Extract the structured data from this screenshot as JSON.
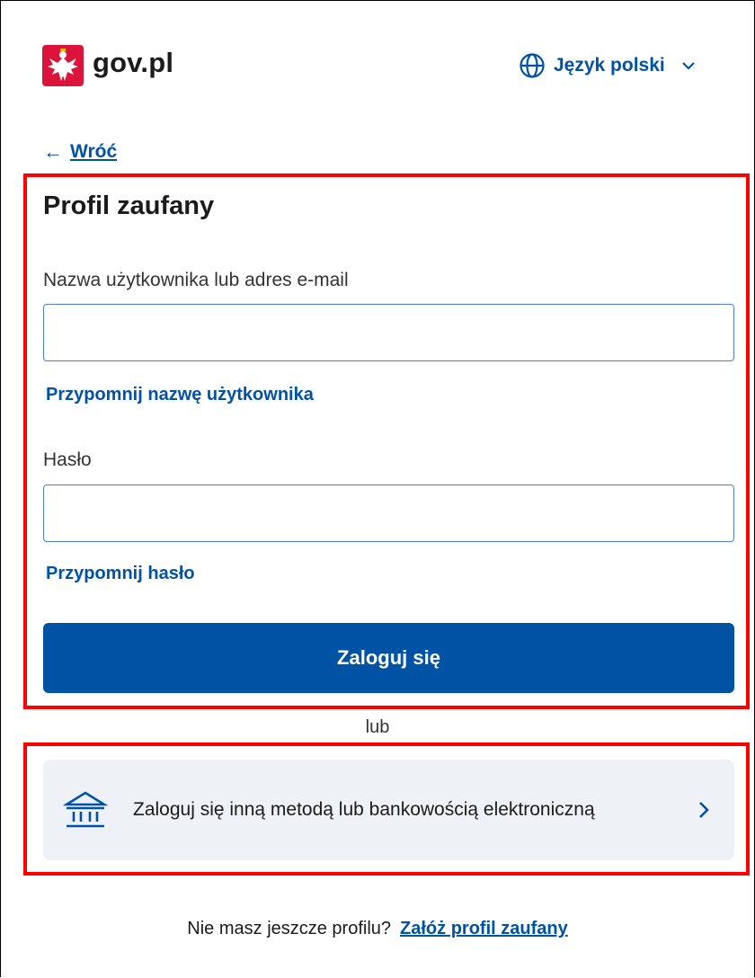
{
  "header": {
    "brand": "gov.pl",
    "language_label": "Język polski",
    "icons": {
      "logo": "polish-eagle-emblem",
      "language": "globe-icon",
      "dropdown": "chevron-down-icon"
    }
  },
  "nav": {
    "back_label": "Wróć",
    "back_icon": "arrow-left-icon"
  },
  "login_form": {
    "title": "Profil zaufany",
    "username_label": "Nazwa użytkownika lub adres e-mail",
    "username_value": "",
    "remind_username_link": "Przypomnij nazwę użytkownika",
    "password_label": "Hasło",
    "password_value": "",
    "remind_password_link": "Przypomnij hasło",
    "submit_label": "Zaloguj się"
  },
  "separator": "lub",
  "alternative_login": {
    "label": "Zaloguj się inną metodą lub bankowością elektroniczną",
    "icon": "bank-icon",
    "chevron": "chevron-right-icon"
  },
  "footer": {
    "text": "Nie masz jeszcze profilu?",
    "link": "Załóż profil zaufany"
  },
  "colors": {
    "primary": "#0052a5",
    "highlight": "#ff0000",
    "alt_background": "#eef2f7",
    "emblem_red": "#dc143c"
  }
}
